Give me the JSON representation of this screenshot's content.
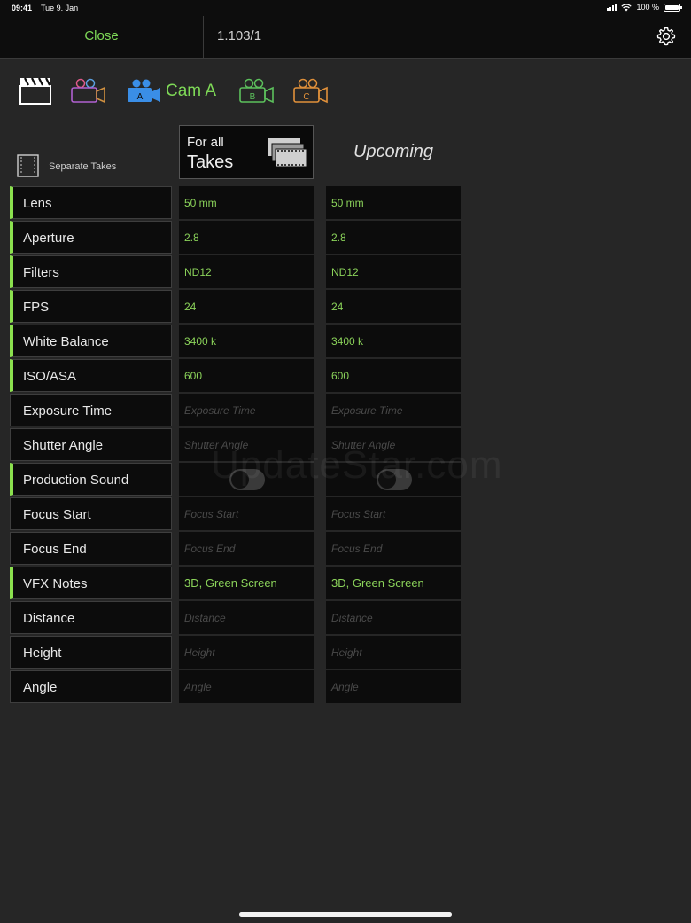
{
  "status": {
    "time": "09:41",
    "date": "Tue 9. Jan",
    "battery": "100 %"
  },
  "nav": {
    "close": "Close",
    "title": "1.103/1"
  },
  "cams": {
    "active_label": "Cam A",
    "badge_a": "A",
    "badge_b": "B",
    "badge_c": "C"
  },
  "separate_takes": "Separate Takes",
  "for_all": {
    "line1": "For all",
    "line2": "Takes"
  },
  "upcoming": "Upcoming",
  "watermark": "UpdateStar.com",
  "rows": [
    {
      "label": "Lens",
      "active": true,
      "for_all": "50 mm",
      "upcoming": "50 mm"
    },
    {
      "label": "Aperture",
      "active": true,
      "for_all": "2.8",
      "upcoming": "2.8"
    },
    {
      "label": "Filters",
      "active": true,
      "for_all": "ND12",
      "upcoming": "ND12"
    },
    {
      "label": "FPS",
      "active": true,
      "for_all": "24",
      "upcoming": "24"
    },
    {
      "label": "White Balance",
      "active": true,
      "for_all": "3400 k",
      "upcoming": "3400 k"
    },
    {
      "label": "ISO/ASA",
      "active": true,
      "for_all": "600",
      "upcoming": "600"
    },
    {
      "label": "Exposure Time",
      "active": false,
      "placeholder": "Exposure Time"
    },
    {
      "label": "Shutter Angle",
      "active": false,
      "placeholder": "Shutter Angle"
    },
    {
      "label": "Production Sound",
      "active": true,
      "toggle": true
    },
    {
      "label": "Focus Start",
      "active": false,
      "placeholder": "Focus Start"
    },
    {
      "label": "Focus End",
      "active": false,
      "placeholder": "Focus End"
    },
    {
      "label": "VFX Notes",
      "active": true,
      "for_all": "3D, Green Screen",
      "upcoming": "3D, Green Screen"
    },
    {
      "label": "Distance",
      "active": false,
      "placeholder": "Distance"
    },
    {
      "label": "Height",
      "active": false,
      "placeholder": "Height"
    },
    {
      "label": "Angle",
      "active": false,
      "placeholder": "Angle"
    }
  ],
  "colors": {
    "accent": "#7ed957",
    "active_bar": "#8be04e",
    "background": "#262626",
    "cell": "#0c0c0c"
  }
}
